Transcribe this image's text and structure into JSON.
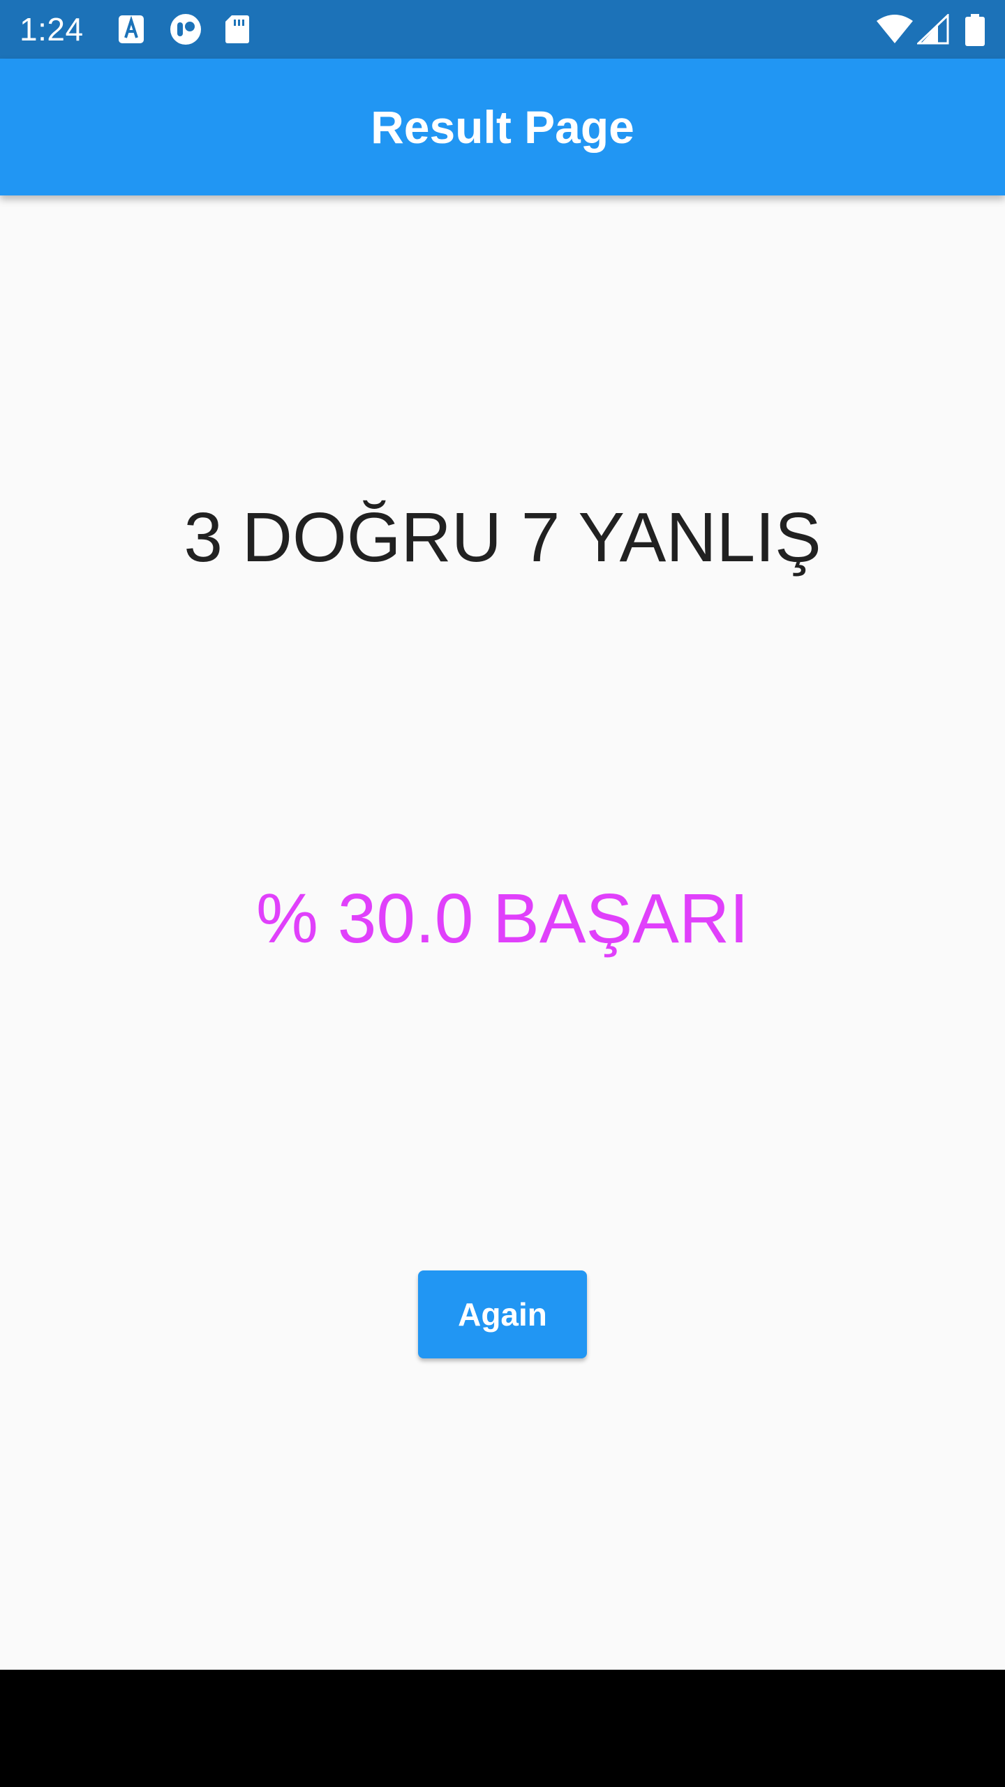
{
  "status_bar": {
    "time": "1:24",
    "left_icons": [
      "font-download-icon",
      "toggle-icon",
      "sd-card-icon"
    ],
    "right_icons": [
      "wifi-icon",
      "signal-icon",
      "battery-icon"
    ],
    "background": "#1C72B8"
  },
  "app_bar": {
    "title": "Result Page",
    "background": "#2196F3"
  },
  "result": {
    "score_text": "3 DOĞRU 7 YANLIŞ",
    "success_text": "% 30.0 BAŞARI",
    "success_color": "#E040FB"
  },
  "actions": {
    "again_label": "Again"
  }
}
